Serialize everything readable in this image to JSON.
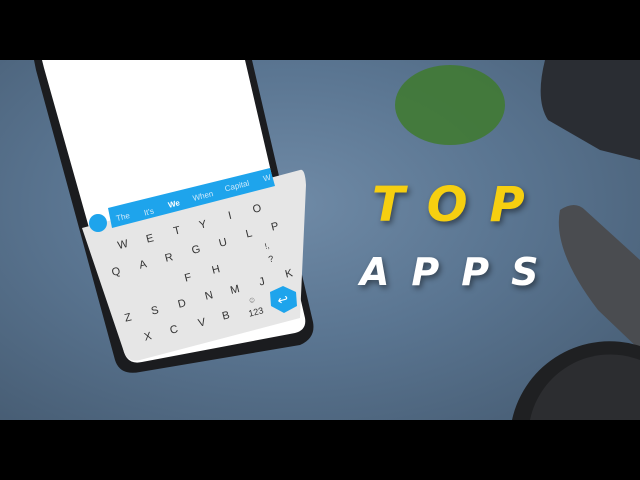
{
  "headline": {
    "line1": "TOP",
    "line2": "APPS"
  },
  "colors": {
    "accent_yellow": "#f6cf10",
    "keyboard_blue": "#1ea4ec",
    "background": "#5a7591"
  },
  "keyboard": {
    "suggestions": [
      "The",
      "It's",
      "We",
      "When",
      "Capital",
      "W"
    ],
    "active_suggestion": "We",
    "keys": [
      "O",
      "I",
      "Y",
      "T",
      "E",
      "W",
      "P",
      "L",
      "U",
      "G",
      "R",
      "A",
      "Q",
      "K",
      "J",
      "H",
      "F",
      "M",
      "N",
      "D",
      "S",
      "Z",
      "B",
      "V",
      "C",
      "X"
    ],
    "punct1": "!,",
    "punct2": "?",
    "symbols_key": "123",
    "emoji_icon": "emoji-icon",
    "enter_icon": "enter-icon",
    "logo_icon": "keyboard-logo-icon"
  }
}
